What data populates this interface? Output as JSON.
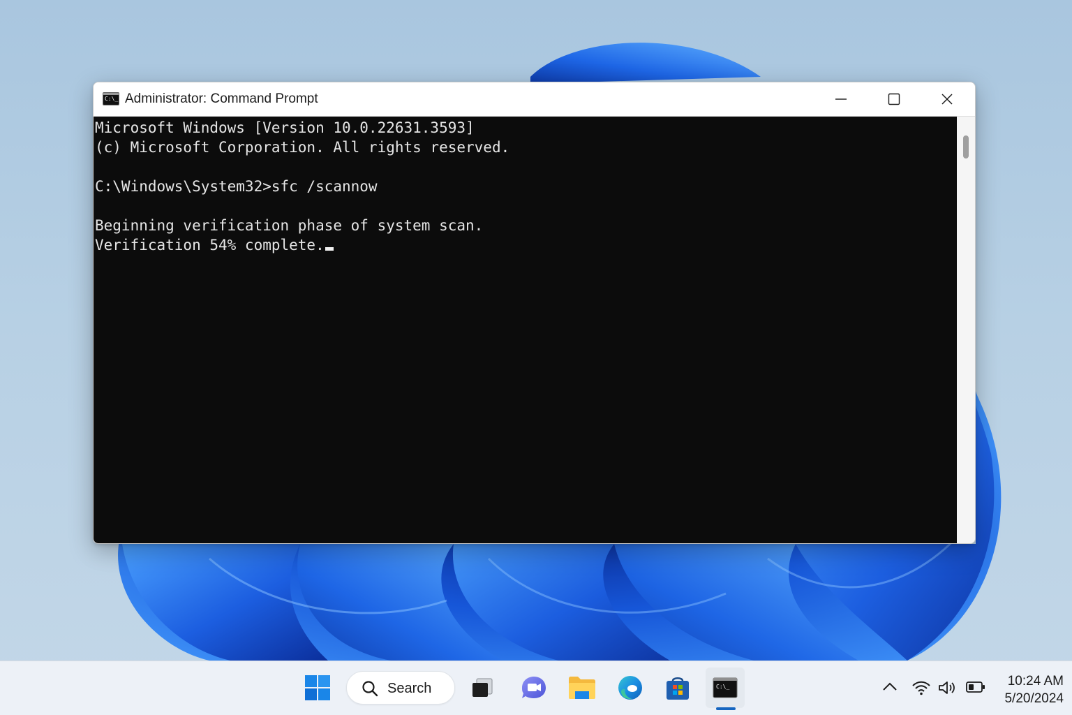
{
  "window": {
    "title": "Administrator: Command Prompt",
    "app_icon_text": "C:\\_"
  },
  "console": {
    "lines": [
      "Microsoft Windows [Version 10.0.22631.3593]",
      "(c) Microsoft Corporation. All rights reserved.",
      "",
      "C:\\Windows\\System32>sfc /scannow",
      "",
      "Beginning verification phase of system scan.",
      "Verification 54% complete."
    ]
  },
  "taskbar": {
    "search_label": "Search",
    "apps": [
      "start-icon",
      "task-view-icon",
      "teams-chat-icon",
      "file-explorer-icon",
      "edge-icon",
      "store-icon",
      "command-prompt-icon"
    ],
    "active_app": "command-prompt-icon",
    "cmd_icon_text": "C:\\_"
  },
  "tray": {
    "time": "10:24 AM",
    "date": "5/20/2024",
    "icons": [
      "chevron-up-icon",
      "wifi-icon",
      "volume-icon",
      "battery-icon"
    ]
  },
  "colors": {
    "accent": "#1565c0",
    "console_bg": "#0c0c0c",
    "console_fg": "#e6e6e6",
    "windows_blue": "#0a74d6"
  }
}
